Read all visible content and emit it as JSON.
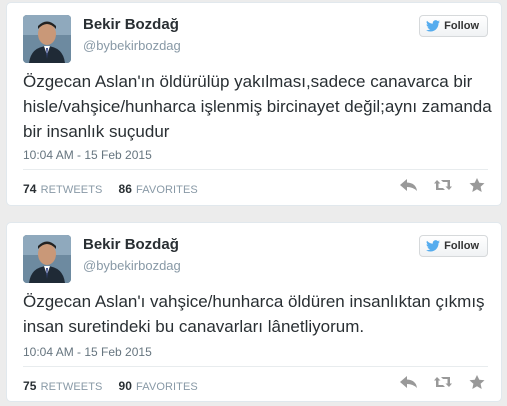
{
  "colors": {
    "name": "#292f33",
    "muted": "#8899a6",
    "twitter_blue": "#55acee",
    "action_gray": "#999999"
  },
  "tweets": [
    {
      "fullname": "Bekir Bozdağ",
      "username": "@bybekirbozdag",
      "follow_label": "Follow",
      "text": "Özgecan Aslan'ın öldürülüp yakılması,sadece canavarca bir hisle/vahşice/hunharca işlenmiş bircinayet değil;aynı zamanda bir insanlık suçudur",
      "timestamp": "10:04 AM - 15 Feb 2015",
      "retweets_count": "74",
      "retweets_label": "RETWEETS",
      "favorites_count": "86",
      "favorites_label": "FAVORITES",
      "icons": [
        "reply-icon",
        "retweet-icon",
        "favorite-icon"
      ]
    },
    {
      "fullname": "Bekir Bozdağ",
      "username": "@bybekirbozdag",
      "follow_label": "Follow",
      "text": "Özgecan Aslan'ı vahşice/hunharca öldüren insanlıktan çıkmış insan suretindeki bu canavarları lânetliyorum.",
      "timestamp": "10:04 AM - 15 Feb 2015",
      "retweets_count": "75",
      "retweets_label": "RETWEETS",
      "favorites_count": "90",
      "favorites_label": "FAVORITES",
      "icons": [
        "reply-icon",
        "retweet-icon",
        "favorite-icon"
      ]
    }
  ]
}
